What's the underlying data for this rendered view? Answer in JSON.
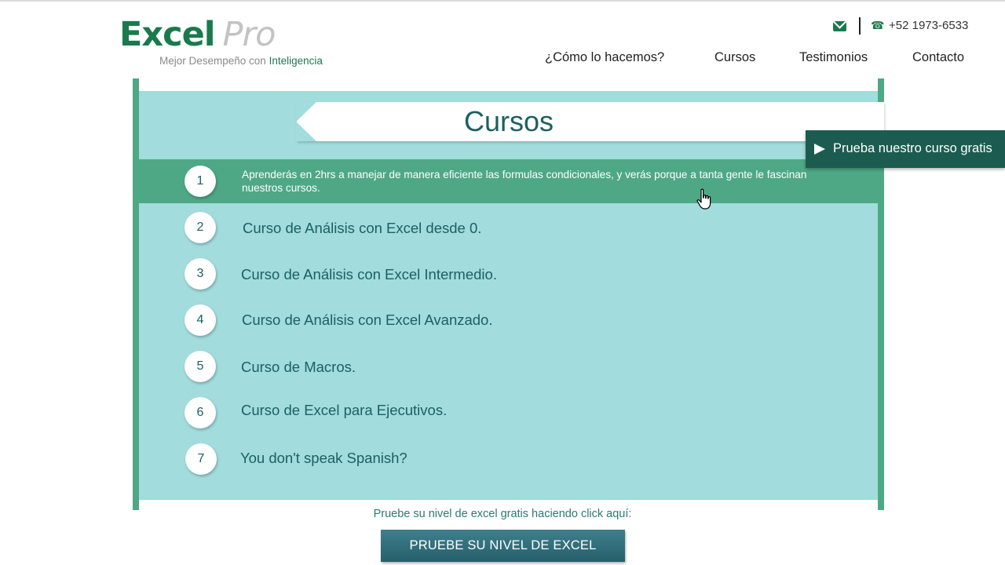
{
  "brand": {
    "name_main": "Excel",
    "name_suffix": "Pro",
    "tagline_prefix": "Mejor Desempeño con ",
    "tagline_highlight": "Inteligencia"
  },
  "contact": {
    "mail_icon": "mail-icon",
    "phone_icon": "phone-icon",
    "phone": "+52 1973-6533"
  },
  "nav": {
    "items": [
      {
        "label": "¿Cómo lo hacemos?"
      },
      {
        "label": "Cursos"
      },
      {
        "label": "Testimonios"
      },
      {
        "label": "Contacto"
      }
    ]
  },
  "main": {
    "title": "Cursos",
    "active_index": 0,
    "courses": [
      {
        "number": "1",
        "text": "Aprenderás en 2hrs a manejar de manera eficiente las formulas condicionales, y verás porque a tanta gente le fascinan nuestros cursos."
      },
      {
        "number": "2",
        "text": "Curso de Análisis con Excel desde 0."
      },
      {
        "number": "3",
        "text": "Curso de Análisis con Excel Intermedio."
      },
      {
        "number": "4",
        "text": "Curso de Análisis con Excel Avanzado."
      },
      {
        "number": "5",
        "text": "Curso de Macros."
      },
      {
        "number": "6",
        "text": "Curso de Excel para Ejecutivos."
      },
      {
        "number": "7",
        "text": "You don't speak Spanish?"
      }
    ]
  },
  "floating_cta": {
    "icon": "play-icon",
    "label": "Prueba nuestro curso gratis"
  },
  "bottom": {
    "hint": "Pruebe su nivel de excel gratis haciendo click aquí:",
    "button_label": "PRUEBE SU NIVEL DE EXCEL"
  },
  "colors": {
    "brand_green": "#1a7a4e",
    "panel_bg": "#a2dcdc",
    "accent_green": "#4ea885",
    "text_teal": "#1c6060",
    "cta_dark": "#1c5c50",
    "button_teal": "#2f6f7c"
  }
}
